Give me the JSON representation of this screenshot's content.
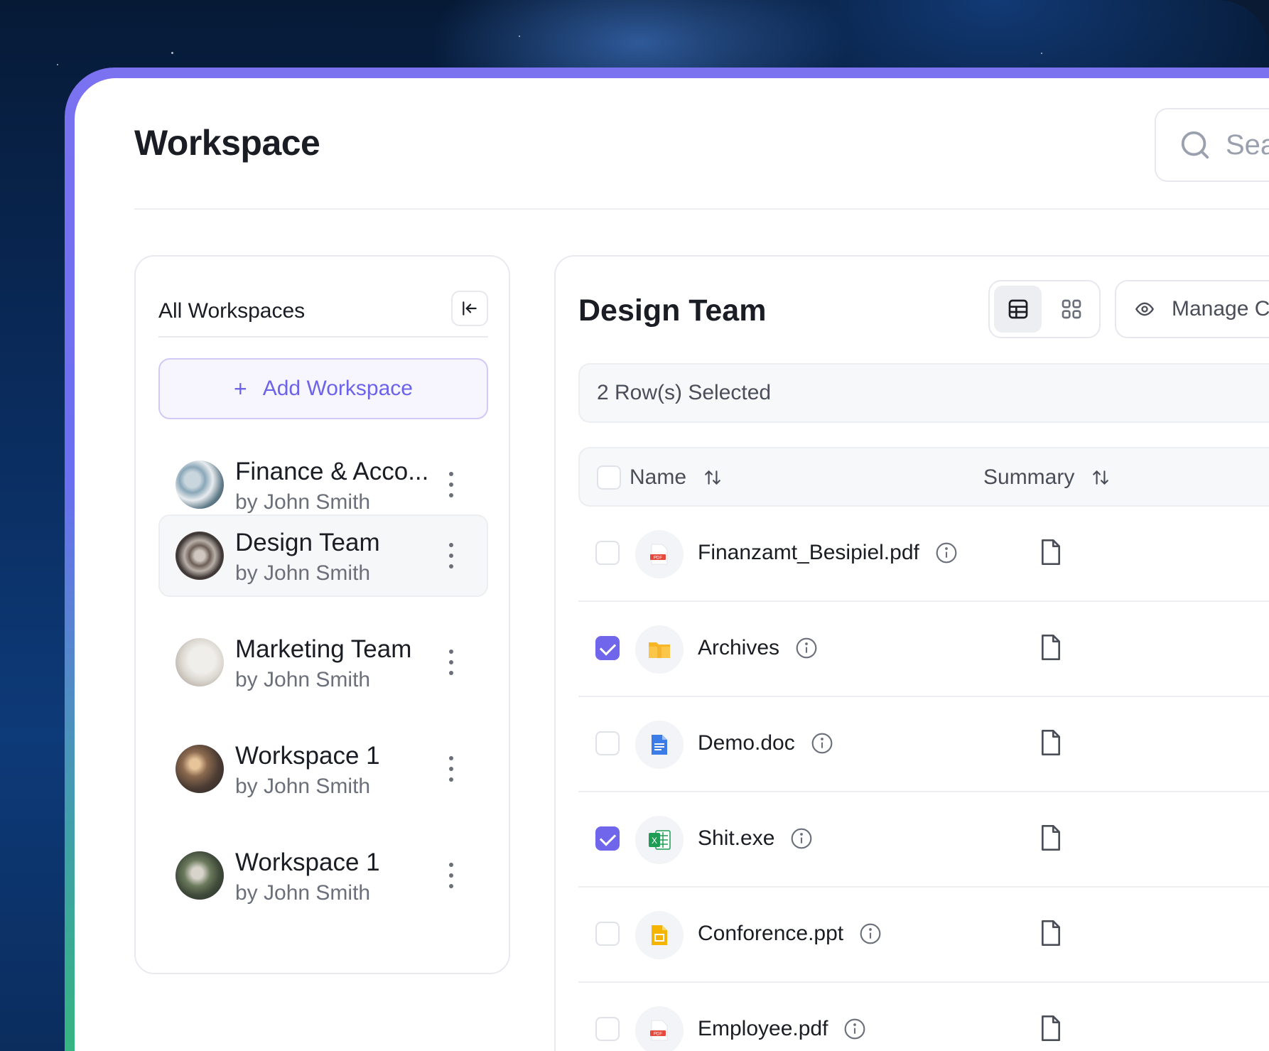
{
  "page": {
    "title": "Workspace",
    "search_placeholder": "Sea"
  },
  "sidebar": {
    "title": "All Workspaces",
    "add_label": "Add Workspace",
    "items": [
      {
        "name": "Finance & Acco...",
        "owner": "by John Smith",
        "active": false
      },
      {
        "name": "Design Team",
        "owner": "by John Smith",
        "active": true
      },
      {
        "name": "Marketing Team",
        "owner": "by John Smith",
        "active": false
      },
      {
        "name": "Workspace 1",
        "owner": "by John Smith",
        "active": false
      },
      {
        "name": "Workspace 1",
        "owner": "by John Smith",
        "active": false
      }
    ]
  },
  "main": {
    "title": "Design Team",
    "manage_label": "Manage Co",
    "selected_text": "2 Row(s) Selected",
    "columns": {
      "name": "Name",
      "summary": "Summary"
    },
    "rows": [
      {
        "name": "Finanzamt_Besipiel.pdf",
        "type": "pdf",
        "checked": false
      },
      {
        "name": "Archives",
        "type": "folder",
        "checked": true
      },
      {
        "name": "Demo.doc",
        "type": "doc",
        "checked": false
      },
      {
        "name": "Shit.exe",
        "type": "sheet",
        "checked": true
      },
      {
        "name": "Conforence.ppt",
        "type": "slides",
        "checked": false
      },
      {
        "name": "Employee.pdf",
        "type": "pdf",
        "checked": false
      }
    ]
  },
  "colors": {
    "accent": "#6f66ec",
    "text": "#1b1d24",
    "muted": "#6b6f7a"
  }
}
